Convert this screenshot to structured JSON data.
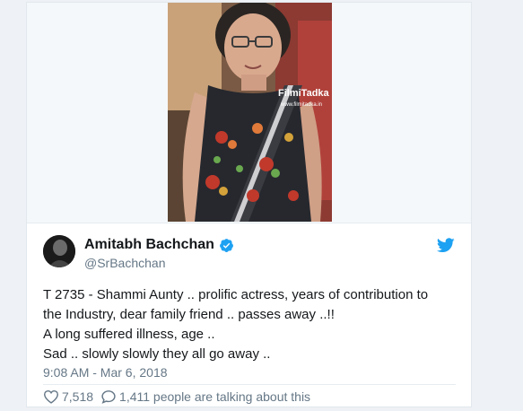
{
  "media": {
    "watermark_title": "FilmiTadka",
    "watermark_url": "www.filmitadka.in"
  },
  "tweet": {
    "display_name": "Amitabh Bachchan",
    "handle": "@SrBachchan",
    "lines": [
      "T 2735 - Shammi Aunty .. prolific actress, years of contribution to",
      "the Industry, dear family friend .. passes away ..!!",
      "A long suffered illness, age ..",
      "Sad .. slowly slowly they all go away .."
    ],
    "timestamp": "9:08 AM - Mar 6, 2018",
    "likes": "7,518",
    "talking": "1,411 people are talking about this"
  },
  "colors": {
    "verified": "#1da1f2",
    "twitter_bird": "#1da1f2",
    "secondary_text": "#657786",
    "primary_text": "#14171a"
  },
  "icons": [
    "verified-badge-icon",
    "twitter-bird-icon",
    "heart-icon",
    "reply-bubble-icon"
  ]
}
